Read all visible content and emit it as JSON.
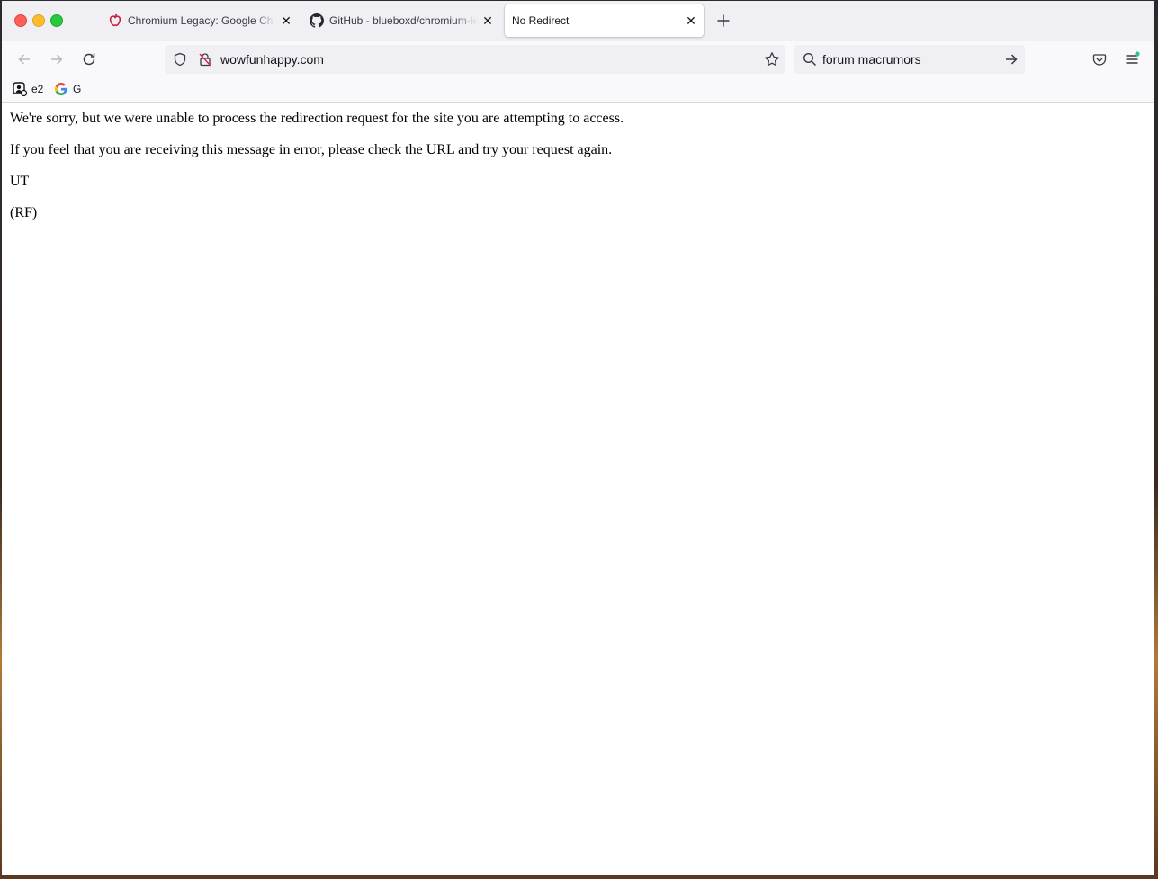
{
  "window": {
    "controls": [
      "close",
      "minimize",
      "zoom"
    ]
  },
  "tabs": [
    {
      "title": "Chromium Legacy: Google Chro",
      "icon": "apple-icon",
      "active": false
    },
    {
      "title": "GitHub - blueboxd/chromium-le",
      "icon": "github-icon",
      "active": false
    },
    {
      "title": "No Redirect",
      "icon": "",
      "active": true
    }
  ],
  "toolbar": {
    "url": "wowfunhappy.com",
    "search_value": "forum macrumors"
  },
  "bookmarks": [
    {
      "label": "e2",
      "icon": "e2-icon"
    },
    {
      "label": "G",
      "icon": "google-icon"
    }
  ],
  "page": {
    "para1": "We're sorry, but we were unable to process the redirection request for the site you are attempting to access.",
    "para2": "If you feel that you are receiving this message in error, please check the URL and try your request again.",
    "para3": "UT",
    "para4": "(RF)"
  },
  "colors": {
    "accent_dot": "#2ac3a2",
    "insecure_icon": "#e22850"
  }
}
